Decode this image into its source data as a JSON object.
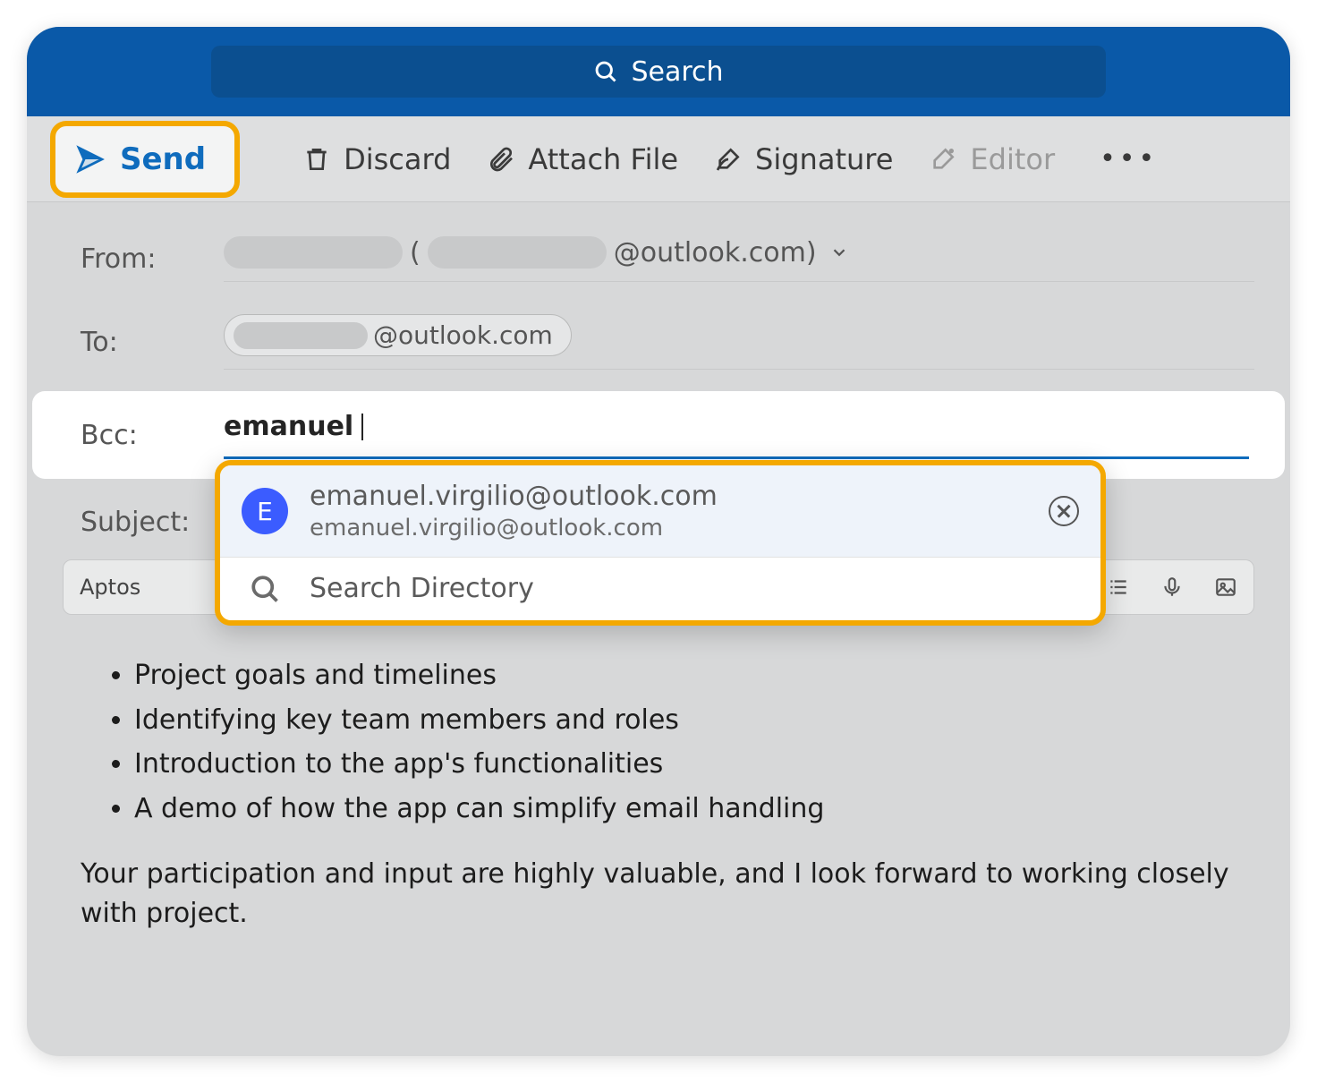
{
  "header": {
    "search_placeholder": "Search"
  },
  "toolbar": {
    "send": "Send",
    "discard": "Discard",
    "attach": "Attach File",
    "signature": "Signature",
    "editor": "Editor"
  },
  "fields": {
    "from_label": "From:",
    "from_domain": "@outlook.com)",
    "to_label": "To:",
    "to_chip_domain": "@outlook.com",
    "bcc_label": "Bcc:",
    "bcc_value": "emanuel",
    "subject_label": "Subject:"
  },
  "dropdown": {
    "suggestion": {
      "initial": "E",
      "primary": "emanuel.virgilio@outlook.com",
      "secondary": "emanuel.virgilio@outlook.com"
    },
    "search_directory": "Search Directory"
  },
  "format_bar": {
    "font": "Aptos"
  },
  "body": {
    "bullets": [
      "Project goals and timelines",
      "Identifying key team members and roles",
      "Introduction to the app's functionalities",
      "A demo of how the app can simplify email handling"
    ],
    "closing": "Your participation and input are highly valuable, and I look forward to working closely with project."
  }
}
